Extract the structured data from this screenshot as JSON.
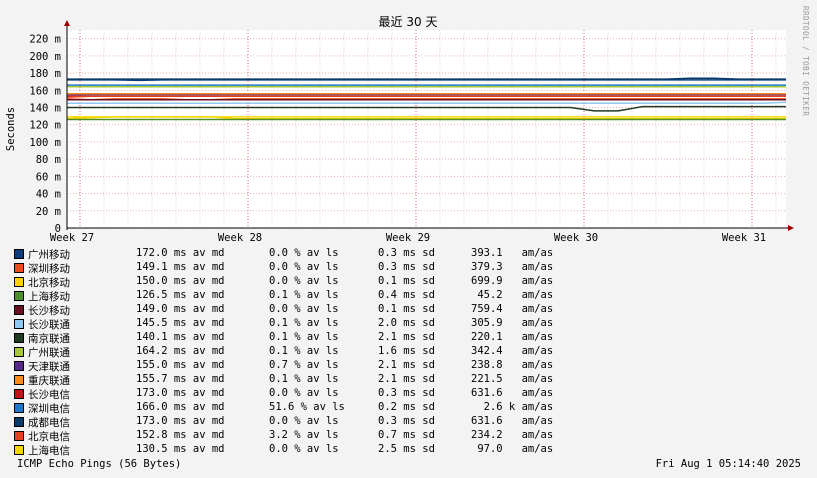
{
  "chart_data": {
    "type": "line",
    "title": "最近 30 天",
    "ylabel": "Seconds",
    "ylim": [
      0,
      230
    ],
    "yticks": [
      0,
      20,
      40,
      60,
      80,
      100,
      120,
      140,
      160,
      180,
      200,
      220
    ],
    "ytick_labels": [
      "0",
      "20 m",
      "40 m",
      "60 m",
      "80 m",
      "100 m",
      "120 m",
      "140 m",
      "160 m",
      "180 m",
      "200 m",
      "220 m"
    ],
    "xtick_labels": [
      "Week 27",
      "Week 28",
      "Week 29",
      "Week 30",
      "Week 31"
    ],
    "grid": true,
    "series": [
      {
        "name": "广州移动",
        "color": "#0b3b7a",
        "values": [
          172,
          172,
          172,
          171.5,
          172,
          172,
          172,
          172,
          172,
          172,
          172,
          172,
          172,
          172,
          172,
          172,
          172,
          172,
          172,
          172,
          172,
          172,
          172,
          172,
          172,
          172,
          172,
          172,
          172,
          172,
          172
        ]
      },
      {
        "name": "深圳移动",
        "color": "#f04a1a",
        "values": [
          150,
          149,
          150,
          150,
          150,
          149,
          149,
          150,
          150,
          150,
          150,
          150,
          150,
          150,
          150,
          150,
          150,
          150,
          150,
          150,
          150,
          150,
          150,
          150,
          150,
          150,
          150,
          150,
          150,
          150,
          150
        ]
      },
      {
        "name": "北京移动",
        "color": "#ffd200",
        "values": [
          127,
          128,
          129,
          129,
          129,
          129,
          129,
          127,
          127,
          127,
          127,
          127,
          127,
          127,
          127,
          127,
          127,
          127,
          127,
          127,
          127,
          127,
          127,
          127,
          127,
          127,
          127,
          127,
          127,
          127,
          127
        ]
      },
      {
        "name": "上海移动",
        "color": "#4f8f2a",
        "values": [
          126,
          126,
          126,
          126,
          126,
          126,
          126,
          126,
          126,
          126,
          126,
          126,
          126,
          126,
          126,
          126,
          126,
          126,
          126,
          126,
          126,
          126,
          126,
          126,
          126,
          126,
          126,
          126,
          126,
          126,
          126
        ]
      },
      {
        "name": "长沙移动",
        "color": "#6a0f1f",
        "values": [
          149,
          149,
          149,
          149,
          149,
          149,
          149,
          149,
          149,
          149,
          149,
          149,
          149,
          149,
          149,
          149,
          149,
          149,
          149,
          149,
          149,
          149,
          149,
          149,
          149,
          149,
          149,
          149,
          149,
          149,
          149
        ]
      },
      {
        "name": "长沙联通",
        "color": "#8fc8f0",
        "values": [
          145,
          145,
          145,
          145,
          145,
          145,
          145,
          145,
          145,
          145,
          145,
          145,
          145,
          145,
          145,
          145,
          145,
          145,
          145,
          145,
          145,
          145,
          145,
          145,
          145,
          145,
          145,
          145,
          145,
          145,
          146
        ]
      },
      {
        "name": "南京联通",
        "color": "#1f3a1f",
        "values": [
          140,
          140,
          140,
          140,
          140,
          140,
          140,
          140,
          140,
          140,
          140,
          140,
          140,
          140,
          140,
          140,
          140,
          140,
          140,
          140,
          140,
          140,
          136,
          136,
          141,
          141,
          141,
          141,
          141,
          141,
          141
        ]
      },
      {
        "name": "广州联通",
        "color": "#a6c93a",
        "values": [
          164,
          164,
          164,
          164,
          164,
          164,
          164,
          164,
          164,
          164,
          164,
          164,
          164,
          164,
          164,
          164,
          164,
          164,
          164,
          164,
          164,
          164,
          164,
          164,
          164,
          164,
          164,
          164,
          164,
          164,
          164
        ]
      },
      {
        "name": "天津联通",
        "color": "#5a2a8a",
        "values": [
          155,
          155,
          155,
          155,
          155,
          155,
          155,
          155,
          155,
          155,
          155,
          155,
          155,
          155,
          155,
          155,
          155,
          155,
          155,
          155,
          155,
          155,
          155,
          155,
          155,
          155,
          155,
          155,
          155,
          155,
          155
        ]
      },
      {
        "name": "重庆联通",
        "color": "#ff8c1a",
        "values": [
          156,
          156,
          156,
          156,
          156,
          156,
          156,
          156,
          156,
          156,
          156,
          156,
          156,
          156,
          156,
          156,
          156,
          156,
          156,
          156,
          156,
          156,
          156,
          156,
          156,
          156,
          156,
          156,
          156,
          156,
          156
        ]
      },
      {
        "name": "长沙电信",
        "color": "#c0141a",
        "values": [
          153,
          153,
          153,
          153,
          153,
          153,
          153,
          153,
          153,
          153,
          153,
          153,
          153,
          153,
          153,
          153,
          153,
          153,
          153,
          153,
          153,
          153,
          153,
          153,
          153,
          153,
          153,
          153,
          153,
          153,
          153
        ]
      },
      {
        "name": "深圳电信",
        "color": "#1f78c8",
        "values": [
          166,
          166,
          166,
          166,
          166,
          166,
          166,
          166,
          166,
          166,
          166,
          166,
          166,
          166,
          166,
          166,
          166,
          166,
          166,
          166,
          166,
          166,
          166,
          166,
          166,
          166,
          166,
          166,
          166,
          166,
          166
        ]
      },
      {
        "name": "成都电信",
        "color": "#0a3a6a",
        "values": [
          173,
          173,
          173,
          173,
          173,
          173,
          173,
          173,
          173,
          173,
          173,
          173,
          173,
          173,
          173,
          173,
          173,
          173,
          173,
          173,
          173,
          173,
          173,
          173,
          173,
          173,
          174,
          174,
          173,
          173,
          173
        ]
      },
      {
        "name": "北京电信",
        "color": "#e8401c",
        "values": [
          152,
          153,
          153,
          153,
          153,
          153,
          153,
          153,
          153,
          153,
          153,
          153,
          153,
          153,
          153,
          153,
          153,
          153,
          153,
          153,
          153,
          153,
          153,
          153,
          153,
          153,
          153,
          153,
          153,
          153,
          153
        ]
      },
      {
        "name": "上海电信",
        "color": "#f5d800",
        "values": [
          129,
          129,
          129,
          129,
          129,
          129,
          129,
          129,
          129,
          129,
          129,
          129,
          129,
          129,
          129,
          129,
          129,
          129,
          129,
          129,
          129,
          129,
          129,
          129,
          129,
          129,
          129,
          129,
          129,
          129,
          129
        ]
      }
    ]
  },
  "legend": [
    {
      "name": "广州移动",
      "color": "#0b3b7a",
      "avg": "172.0 ms av md",
      "loss": "0.0 % av ls",
      "sd": "0.3 ms sd",
      "amas": "393.1   am/as"
    },
    {
      "name": "深圳移动",
      "color": "#f04a1a",
      "avg": "149.1 ms av md",
      "loss": "0.0 % av ls",
      "sd": "0.3 ms sd",
      "amas": "379.3   am/as"
    },
    {
      "name": "北京移动",
      "color": "#ffd200",
      "avg": "150.0 ms av md",
      "loss": "0.0 % av ls",
      "sd": "0.1 ms sd",
      "amas": "699.9   am/as"
    },
    {
      "name": "上海移动",
      "color": "#4f8f2a",
      "avg": "126.5 ms av md",
      "loss": "0.1 % av ls",
      "sd": "0.4 ms sd",
      "amas": " 45.2   am/as"
    },
    {
      "name": "长沙移动",
      "color": "#6a0f1f",
      "avg": "149.0 ms av md",
      "loss": "0.0 % av ls",
      "sd": "0.1 ms sd",
      "amas": "759.4   am/as"
    },
    {
      "name": "长沙联通",
      "color": "#8fc8f0",
      "avg": "145.5 ms av md",
      "loss": "0.1 % av ls",
      "sd": "2.0 ms sd",
      "amas": "305.9   am/as"
    },
    {
      "name": "南京联通",
      "color": "#1f3a1f",
      "avg": "140.1 ms av md",
      "loss": "0.1 % av ls",
      "sd": "2.1 ms sd",
      "amas": "220.1   am/as"
    },
    {
      "name": "广州联通",
      "color": "#a6c93a",
      "avg": "164.2 ms av md",
      "loss": "0.1 % av ls",
      "sd": "1.6 ms sd",
      "amas": "342.4   am/as"
    },
    {
      "name": "天津联通",
      "color": "#5a2a8a",
      "avg": "155.0 ms av md",
      "loss": "0.7 % av ls",
      "sd": "2.1 ms sd",
      "amas": "238.8   am/as"
    },
    {
      "name": "重庆联通",
      "color": "#ff8c1a",
      "avg": "155.7 ms av md",
      "loss": "0.1 % av ls",
      "sd": "2.1 ms sd",
      "amas": "221.5   am/as"
    },
    {
      "name": "长沙电信",
      "color": "#c0141a",
      "avg": "173.0 ms av md",
      "loss": "0.0 % av ls",
      "sd": "0.3 ms sd",
      "amas": "631.6   am/as"
    },
    {
      "name": "深圳电信",
      "color": "#1f78c8",
      "avg": "166.0 ms av md",
      "loss": "51.6 % av ls",
      "sd": "0.2 ms sd",
      "amas": "  2.6 k am/as"
    },
    {
      "name": "成都电信",
      "color": "#0a3a6a",
      "avg": "173.0 ms av md",
      "loss": "0.0 % av ls",
      "sd": "0.3 ms sd",
      "amas": "631.6   am/as"
    },
    {
      "name": "北京电信",
      "color": "#e8401c",
      "avg": "152.8 ms av md",
      "loss": "3.2 % av ls",
      "sd": "0.7 ms sd",
      "amas": "234.2   am/as"
    },
    {
      "name": "上海电信",
      "color": "#f5d800",
      "avg": "130.5 ms av md",
      "loss": "0.0 % av ls",
      "sd": "2.5 ms sd",
      "amas": " 97.0   am/as"
    }
  ],
  "footer": {
    "left": "ICMP Echo Pings (56 Bytes)",
    "right": "Fri Aug  1 05:14:40 2025"
  },
  "credit": "RRDTOOL / TOBI OETIKER"
}
